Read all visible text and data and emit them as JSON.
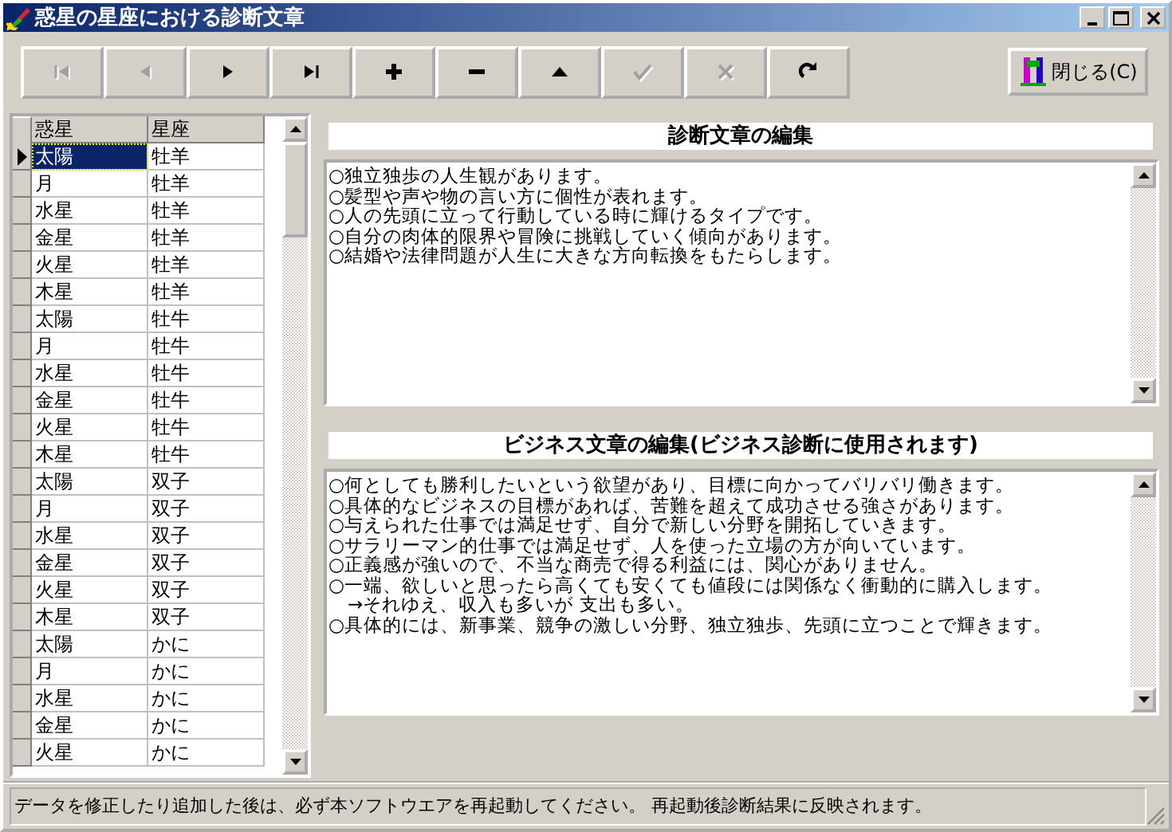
{
  "window": {
    "title": "惑星の星座における診断文章"
  },
  "toolbar": {
    "buttons": [
      {
        "kind": "first",
        "disabled": true
      },
      {
        "kind": "prior",
        "disabled": true
      },
      {
        "kind": "next",
        "disabled": false
      },
      {
        "kind": "last",
        "disabled": false
      },
      {
        "kind": "insert",
        "disabled": false
      },
      {
        "kind": "delete",
        "disabled": false
      },
      {
        "kind": "edit",
        "disabled": false
      },
      {
        "kind": "post",
        "disabled": true
      },
      {
        "kind": "cancel",
        "disabled": true
      },
      {
        "kind": "refresh",
        "disabled": false
      }
    ],
    "close_button": {
      "label": "閉じる(C)"
    }
  },
  "grid": {
    "columns": [
      "惑星",
      "星座"
    ],
    "rows": [
      {
        "planet": "太陽",
        "sign": "牡羊",
        "selected": true
      },
      {
        "planet": "月",
        "sign": "牡羊",
        "selected": false
      },
      {
        "planet": "水星",
        "sign": "牡羊",
        "selected": false
      },
      {
        "planet": "金星",
        "sign": "牡羊",
        "selected": false
      },
      {
        "planet": "火星",
        "sign": "牡羊",
        "selected": false
      },
      {
        "planet": "木星",
        "sign": "牡羊",
        "selected": false
      },
      {
        "planet": "太陽",
        "sign": "牡牛",
        "selected": false
      },
      {
        "planet": "月",
        "sign": "牡牛",
        "selected": false
      },
      {
        "planet": "水星",
        "sign": "牡牛",
        "selected": false
      },
      {
        "planet": "金星",
        "sign": "牡牛",
        "selected": false
      },
      {
        "planet": "火星",
        "sign": "牡牛",
        "selected": false
      },
      {
        "planet": "木星",
        "sign": "牡牛",
        "selected": false
      },
      {
        "planet": "太陽",
        "sign": "双子",
        "selected": false
      },
      {
        "planet": "月",
        "sign": "双子",
        "selected": false
      },
      {
        "planet": "水星",
        "sign": "双子",
        "selected": false
      },
      {
        "planet": "金星",
        "sign": "双子",
        "selected": false
      },
      {
        "planet": "火星",
        "sign": "双子",
        "selected": false
      },
      {
        "planet": "木星",
        "sign": "双子",
        "selected": false
      },
      {
        "planet": "太陽",
        "sign": "かに",
        "selected": false
      },
      {
        "planet": "月",
        "sign": "かに",
        "selected": false
      },
      {
        "planet": "水星",
        "sign": "かに",
        "selected": false
      },
      {
        "planet": "金星",
        "sign": "かに",
        "selected": false
      },
      {
        "planet": "火星",
        "sign": "かに",
        "selected": false
      }
    ]
  },
  "editors": [
    {
      "title": "診断文章の編集",
      "lines": [
        "○独立独歩の人生観があります。",
        "○髪型や声や物の言い方に個性が表れます。",
        "○人の先頭に立って行動している時に輝けるタイプです。",
        "○自分の肉体的限界や冒険に挑戦していく傾向があります。",
        "○結婚や法律問題が人生に大きな方向転換をもたらします。"
      ]
    },
    {
      "title": "ビジネス文章の編集(ビジネス診断に使用されます)",
      "lines": [
        "○何としても勝利したいという欲望があり、目標に向かってバリバリ働きます。",
        "○具体的なビジネスの目標があれば、苦難を超えて成功させる強さがあります。",
        "○与えられた仕事では満足せず、自分で新しい分野を開拓していきます。",
        "○サラリーマン的仕事では満足せず、人を使った立場の方が向いています。",
        "○正義感が強いので、不当な商売で得る利益には、関心がありません。",
        "○一端、欲しいと思ったら高くても安くても値段には関係なく衝動的に購入します。",
        "　→それゆえ、収入も多いが 支出も多い。",
        "○具体的には、新事業、競争の激しい分野、独立独歩、先頭に立つことで輝きます。"
      ]
    }
  ],
  "status_bar": {
    "text": "データを修正したり追加した後は、必ず本ソフトウエアを再起動してください。 再起動後診断結果に反映されます。"
  }
}
